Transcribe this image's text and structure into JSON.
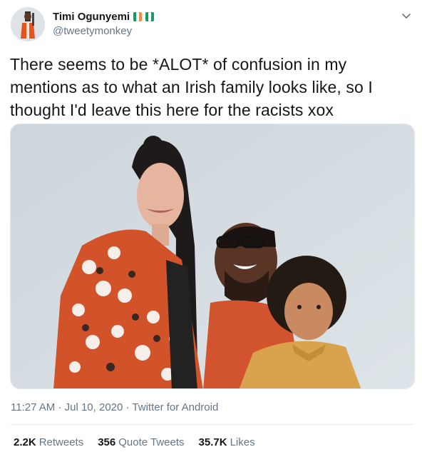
{
  "author": {
    "display_name": "Timi Ogunyemi",
    "handle": "@tweetymonkey",
    "flag_colors": [
      "#169b62",
      "#ffffff",
      "#ff883e"
    ]
  },
  "tweet": {
    "text": "There seems to be *ALOT* of confusion in my mentions as to what an Irish family looks like, so I thought I'd leave this here for the racists xox",
    "time": "11:27 AM",
    "separator": "·",
    "date": "Jul 10, 2020",
    "source": "Twitter for Android"
  },
  "stats": {
    "retweets_count": "2.2K",
    "retweets_label": "Retweets",
    "quotes_count": "356",
    "quotes_label": "Quote Tweets",
    "likes_count": "35.7K",
    "likes_label": "Likes"
  },
  "colors": {
    "text_primary": "#14171a",
    "text_secondary": "#657786",
    "divider": "#e6ecf0",
    "photo_background": "#d3dce2"
  },
  "icons": {
    "menu": "chevron-down-icon"
  }
}
